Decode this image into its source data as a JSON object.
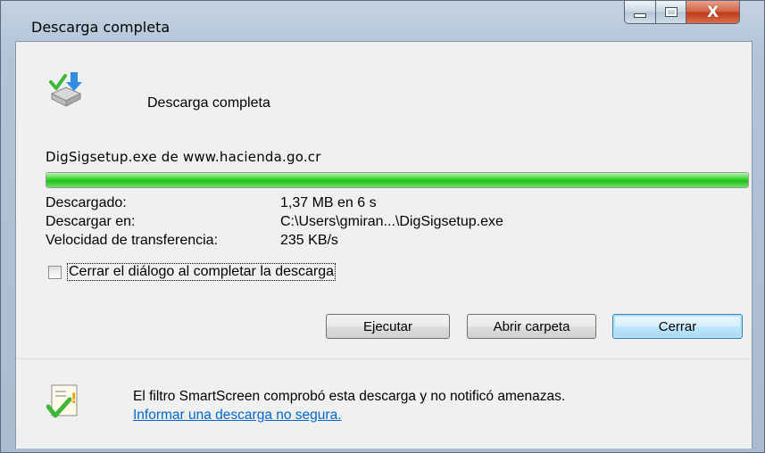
{
  "window": {
    "title": "Descarga completa",
    "caption_buttons": {
      "minimize": "minimize",
      "maximize": "maximize",
      "close": "X"
    }
  },
  "header": {
    "icon": "download-complete-icon",
    "text": "Descarga completa"
  },
  "file": {
    "line": "DigSigsetup.exe de www.hacienda.go.cr",
    "progress_percent": 100
  },
  "details": [
    {
      "label": "Descargado:",
      "value": "1,37 MB en 6 s"
    },
    {
      "label": "Descargar en:",
      "value": "C:\\Users\\gmiran...\\DigSigsetup.exe"
    },
    {
      "label": "Velocidad de transferencia:",
      "value": "235 KB/s"
    }
  ],
  "close_on_complete": {
    "label": "Cerrar el diálogo al completar la descarga",
    "checked": false
  },
  "buttons": {
    "run": "Ejecutar",
    "open_folder": "Abrir carpeta",
    "close": "Cerrar"
  },
  "smartscreen": {
    "icon": "smartscreen-check-icon",
    "message": "El filtro SmartScreen comprobó esta descarga y no notificó amenazas.",
    "link": "Informar una descarga no segura."
  },
  "colors": {
    "progress": "#22c21c",
    "link": "#0066cc",
    "close_button": "#c6421f"
  }
}
